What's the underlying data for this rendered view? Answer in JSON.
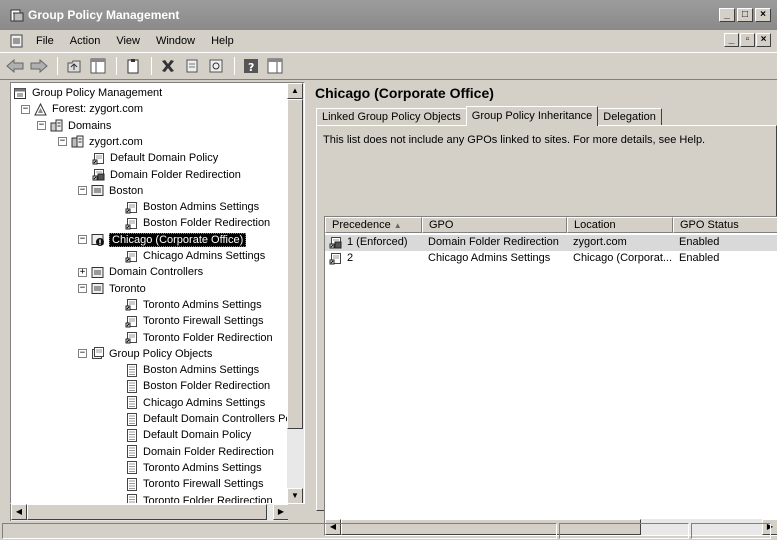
{
  "window": {
    "title": "Group Policy Management"
  },
  "menu": [
    "File",
    "Action",
    "View",
    "Window",
    "Help"
  ],
  "tree": [
    {
      "label": "Group Policy Management",
      "level": 0,
      "icon": "console-icon",
      "expander": ""
    },
    {
      "label": "Forest: zygort.com",
      "level": 1,
      "icon": "forest-icon",
      "expander": "−"
    },
    {
      "label": "Domains",
      "level": 2,
      "icon": "domains-icon",
      "expander": "−"
    },
    {
      "label": "zygort.com",
      "level": 3,
      "icon": "domain-icon",
      "expander": "−"
    },
    {
      "label": "Default Domain Policy",
      "level": 4,
      "icon": "gpo-link-icon",
      "expander": ""
    },
    {
      "label": "Domain Folder Redirection",
      "level": 4,
      "icon": "gpo-link-enforced-icon",
      "expander": ""
    },
    {
      "label": "Boston",
      "level": 4,
      "icon": "ou-icon",
      "expander": "−"
    },
    {
      "label": "Boston Admins Settings",
      "level": 5,
      "icon": "gpo-link-icon",
      "expander": ""
    },
    {
      "label": "Boston Folder Redirection",
      "level": 5,
      "icon": "gpo-link-icon",
      "expander": ""
    },
    {
      "label": "Chicago (Corporate Office)",
      "level": 4,
      "icon": "ou-blocked-icon",
      "expander": "−",
      "selected": true
    },
    {
      "label": "Chicago Admins Settings",
      "level": 5,
      "icon": "gpo-link-icon",
      "expander": ""
    },
    {
      "label": "Domain Controllers",
      "level": 4,
      "icon": "ou-icon",
      "expander": "+"
    },
    {
      "label": "Toronto",
      "level": 4,
      "icon": "ou-icon",
      "expander": "−"
    },
    {
      "label": "Toronto Admins Settings",
      "level": 5,
      "icon": "gpo-link-icon",
      "expander": ""
    },
    {
      "label": "Toronto Firewall Settings",
      "level": 5,
      "icon": "gpo-link-icon",
      "expander": ""
    },
    {
      "label": "Toronto Folder Redirection",
      "level": 5,
      "icon": "gpo-link-icon",
      "expander": ""
    },
    {
      "label": "Group Policy Objects",
      "level": 4,
      "icon": "gpo-container-icon",
      "expander": "−"
    },
    {
      "label": "Boston Admins Settings",
      "level": 5,
      "icon": "gpo-icon",
      "expander": ""
    },
    {
      "label": "Boston Folder Redirection",
      "level": 5,
      "icon": "gpo-icon",
      "expander": ""
    },
    {
      "label": "Chicago Admins Settings",
      "level": 5,
      "icon": "gpo-icon",
      "expander": ""
    },
    {
      "label": "Default Domain Controllers Polic",
      "level": 5,
      "icon": "gpo-icon",
      "expander": ""
    },
    {
      "label": "Default Domain Policy",
      "level": 5,
      "icon": "gpo-icon",
      "expander": ""
    },
    {
      "label": "Domain Folder Redirection",
      "level": 5,
      "icon": "gpo-icon",
      "expander": ""
    },
    {
      "label": "Toronto Admins Settings",
      "level": 5,
      "icon": "gpo-icon",
      "expander": ""
    },
    {
      "label": "Toronto Firewall Settings",
      "level": 5,
      "icon": "gpo-icon",
      "expander": ""
    },
    {
      "label": "Toronto Folder Redirection",
      "level": 5,
      "icon": "gpo-icon",
      "expander": ""
    }
  ],
  "details": {
    "title": "Chicago (Corporate Office)",
    "tabs": [
      "Linked Group Policy Objects",
      "Group Policy Inheritance",
      "Delegation"
    ],
    "active_tab": "Group Policy Inheritance",
    "note": "This list does not include any GPOs linked to sites. For more details, see Help.",
    "columns": [
      "Precedence",
      "GPO",
      "Location",
      "GPO Status"
    ],
    "rows": [
      {
        "precedence": "1 (Enforced)",
        "gpo": "Domain Folder Redirection",
        "location": "zygort.com",
        "status": "Enabled",
        "icon": "gpo-link-enforced-icon"
      },
      {
        "precedence": "2",
        "gpo": "Chicago Admins Settings",
        "location": "Chicago (Corporat...",
        "status": "Enabled",
        "icon": "gpo-link-icon"
      }
    ]
  }
}
